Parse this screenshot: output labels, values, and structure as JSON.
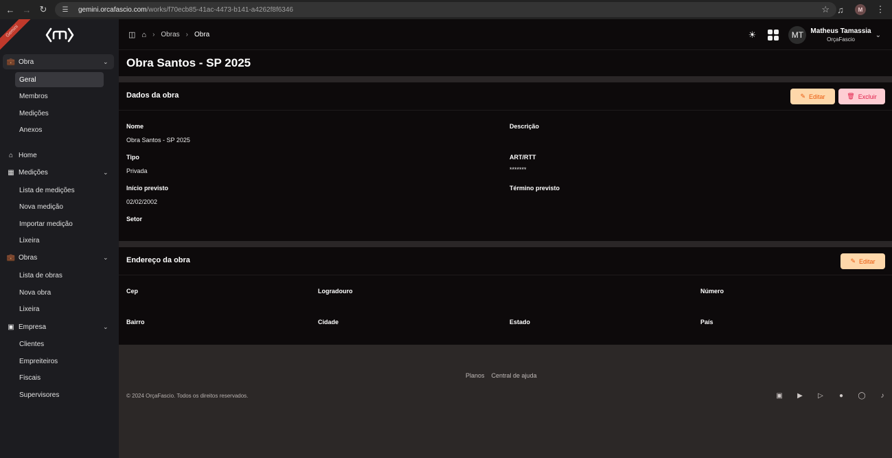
{
  "browser": {
    "url_host": "gemini.orcafascio.com",
    "url_path": "/works/f70ecb85-41ac-4473-b141-a4262f8f6346",
    "profile_initial": "M"
  },
  "sidebar": {
    "ribbon_text": "Gemini",
    "obra_group": {
      "label": "Obra",
      "items": [
        "Geral",
        "Membros",
        "Medições",
        "Anexos"
      ]
    },
    "home_label": "Home",
    "medicoes_group": {
      "label": "Medições",
      "items": [
        "Lista de medições",
        "Nova medição",
        "Importar medição",
        "Lixeira"
      ]
    },
    "obras_group": {
      "label": "Obras",
      "items": [
        "Lista de obras",
        "Nova obra",
        "Lixeira"
      ]
    },
    "empresa_group": {
      "label": "Empresa",
      "items": [
        "Clientes",
        "Empreiteiros",
        "Fiscais",
        "Supervisores"
      ]
    }
  },
  "topbar": {
    "breadcrumb": [
      "Obras",
      "Obra"
    ],
    "user_initials": "MT",
    "user_name": "Matheus Tamassia",
    "user_org": "OrçaFascio"
  },
  "page": {
    "title": "Obra Santos - SP 2025"
  },
  "dados": {
    "title": "Dados da obra",
    "edit_label": "Editar",
    "delete_label": "Excluir",
    "nome_label": "Nome",
    "nome_value": "Obra Santos - SP 2025",
    "descricao_label": "Descrição",
    "descricao_value": "",
    "tipo_label": "Tipo",
    "tipo_value": "Privada",
    "art_label": "ART/RTT",
    "art_value": "*******",
    "inicio_label": "Início previsto",
    "inicio_value": "02/02/2002",
    "termino_label": "Término previsto",
    "termino_value": "",
    "setor_label": "Setor",
    "setor_value": ""
  },
  "endereco": {
    "title": "Endereço da obra",
    "edit_label": "Editar",
    "cep_label": "Cep",
    "logradouro_label": "Logradouro",
    "numero_label": "Número",
    "bairro_label": "Bairro",
    "cidade_label": "Cidade",
    "estado_label": "Estado",
    "pais_label": "País"
  },
  "footer": {
    "links": [
      "Planos",
      "Central de ajuda"
    ],
    "copyright": "© 2024 OrçaFascio. Todos os direitos reservados.",
    "socials": [
      "linkedin-icon",
      "play-icon",
      "youtube-icon",
      "facebook-icon",
      "instagram-icon",
      "tiktok-icon"
    ]
  }
}
